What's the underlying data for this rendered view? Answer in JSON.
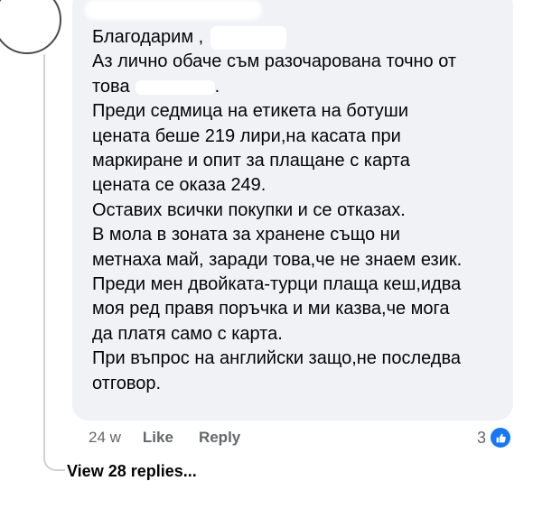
{
  "comment": {
    "lines": [
      "Благодарим ,",
      "Аз лично обаче съм разочарована точно от",
      "това",
      "Преди седмица на етикета на ботуши",
      "цената беше 219 лири,на касата при",
      "маркиране и опит за плащане с карта",
      "цената се оказа 249.",
      "Оставих всички покупки и се отказах.",
      "В мола в зоната за хранене също ни",
      "метнаха май, заради това,че не знаем език.",
      "Преди мен двойката-турци плаща кеш,идва",
      "моя ред правя поръчка и ми казва,че мога",
      "да платя само с карта.",
      "При въпрос на английски защо,не последва",
      "отговор."
    ],
    "line3_suffix": "."
  },
  "actions": {
    "time": "24 w",
    "like": "Like",
    "reply": "Reply"
  },
  "reactions": {
    "count": "3",
    "icon": "thumbs-up-icon",
    "color": "#1877f2"
  },
  "replies": {
    "label": "View 28 replies..."
  }
}
